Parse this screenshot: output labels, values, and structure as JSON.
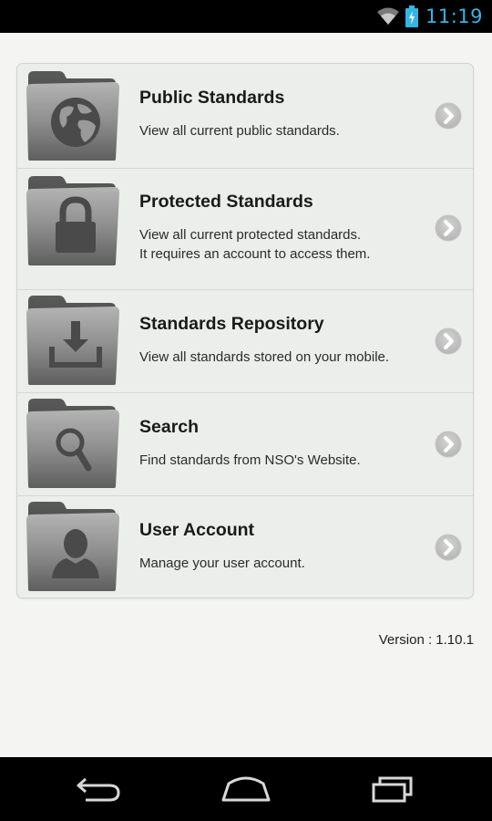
{
  "status_bar": {
    "time": "11:19",
    "icons": [
      "wifi-icon",
      "battery-charging-icon"
    ],
    "accent_color": "#33b5e5"
  },
  "menu": {
    "items": [
      {
        "title": "Public Standards",
        "desc_line1": "View all current public standards.",
        "desc_line2": "",
        "icon": "globe-icon"
      },
      {
        "title": "Protected Standards",
        "desc_line1": "View all current protected standards.",
        "desc_line2": "It requires an account to access them.",
        "icon": "lock-icon"
      },
      {
        "title": "Standards Repository",
        "desc_line1": "View all standards stored on your mobile.",
        "desc_line2": "",
        "icon": "download-icon"
      },
      {
        "title": "Search",
        "desc_line1": "Find standards from NSO's Website.",
        "desc_line2": "",
        "icon": "magnifier-icon"
      },
      {
        "title": "User Account",
        "desc_line1": "Manage your user account.",
        "desc_line2": "",
        "icon": "user-icon"
      }
    ]
  },
  "footer": {
    "version": "Version : 1.10.1"
  },
  "nav_bar": {
    "buttons": [
      "back-icon",
      "home-icon",
      "recents-icon"
    ]
  }
}
